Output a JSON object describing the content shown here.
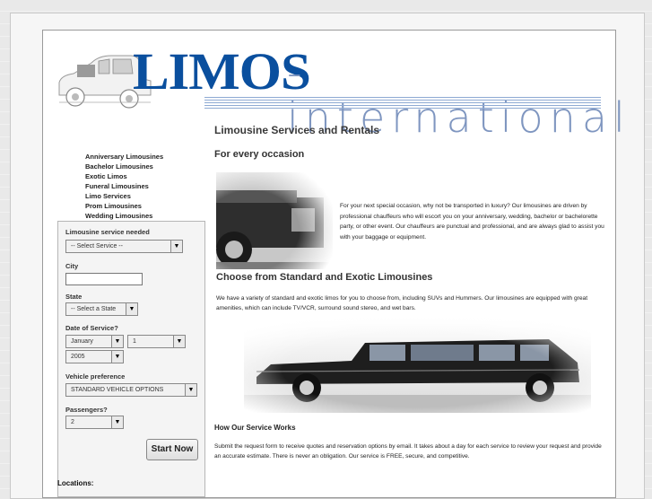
{
  "header": {
    "logo_primary": "LIMOS",
    "logo_secondary": "-international"
  },
  "sidebar": {
    "services": [
      "Anniversary Limousines",
      "Bachelor Limousines",
      "Exotic Limos",
      "Funeral Limousines",
      "Limo Services",
      "Prom Limousines",
      "Wedding Limousines"
    ]
  },
  "form": {
    "service_label": "Limousine service needed",
    "service_selected": "-- Select Service --",
    "city_label": "City",
    "city_value": "",
    "state_label": "State",
    "state_selected": "-- Select a State",
    "date_label": "Date of Service?",
    "month_selected": "January",
    "day_selected": "1",
    "year_selected": "2005",
    "vehicle_label": "Vehicle preference",
    "vehicle_selected": "STANDARD VEHICLE OPTIONS",
    "passengers_label": "Passengers?",
    "passengers_selected": "2",
    "submit_label": "Start Now"
  },
  "footer": {
    "locations_label": "Locations:"
  },
  "main": {
    "title": "Limousine Services and Rentals",
    "subtitle": "For every occasion",
    "intro": "For your next special occasion, why not be transported in luxury? Our limousines are driven by professional chauffeurs who will escort you on your anniversary, wedding, bachelor or bachelorette party, or other event. Our chauffeurs are punctual and professional, and are always glad to assist you with your baggage or equipment.",
    "section2_title": "Choose from Standard and Exotic Limousines",
    "section2_text": "We have a variety of standard and exotic limos for you to choose from, including SUVs and Hummers. Our limousines are equipped with great amenities, which can include TV/VCR, surround sound stereo, and wet bars.",
    "how_title": "How Our Service Works",
    "how_text": "Submit the request form to receive quotes and reservation options by email. It takes about a day for each service to review your request and provide an accurate estimate. There is never an obligation. Our service is FREE, secure, and competitive."
  },
  "colors": {
    "logo_blue": "#0a4f9e",
    "logo_light": "#7f96c0"
  }
}
